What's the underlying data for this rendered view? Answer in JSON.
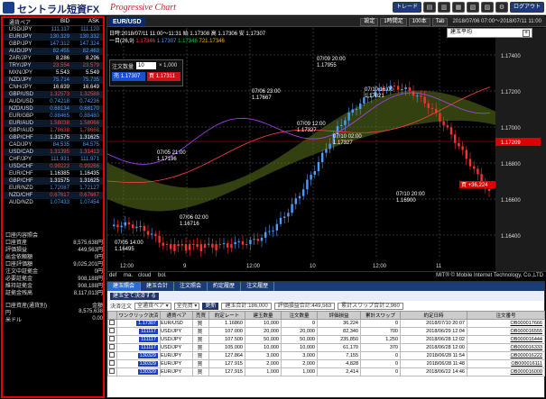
{
  "titlebar": {
    "brand": "セントラル短資FX",
    "brand_sub": "Progressive Chart",
    "trade_btn": "トレード",
    "logout_btn": "ログアウト"
  },
  "rates": {
    "headers": [
      "通貨ペア",
      "BID",
      "ASK"
    ],
    "rows": [
      {
        "pair": "USD/JPY",
        "bid": "111.117",
        "ask": "111.120",
        "dir": "b"
      },
      {
        "pair": "EUR/JPY",
        "bid": "130.329",
        "ask": "130.332",
        "dir": "b"
      },
      {
        "pair": "GBP/JPY",
        "bid": "147.312",
        "ask": "147.324",
        "dir": "b"
      },
      {
        "pair": "AUD/JPY",
        "bid": "82.455",
        "ask": "82.463",
        "dir": "b"
      },
      {
        "pair": "ZAR/JPY",
        "bid": "8.286",
        "ask": "8.296",
        "dir": "w"
      },
      {
        "pair": "TRY/JPY",
        "bid": "23.554",
        "ask": "23.579",
        "dir": "r"
      },
      {
        "pair": "MXN/JPY",
        "bid": "5.543",
        "ask": "5.549",
        "dir": "w"
      },
      {
        "pair": "NZD/JPY",
        "bid": "75.714",
        "ask": "75.735",
        "dir": "b"
      },
      {
        "pair": "CNH/JPY",
        "bid": "16.639",
        "ask": "16.649",
        "dir": "w"
      },
      {
        "pair": "GBP/USD",
        "bid": "1.32573",
        "ask": "1.32588",
        "dir": "r"
      },
      {
        "pair": "AUD/USD",
        "bid": "0.74218",
        "ask": "0.74236",
        "dir": "b"
      },
      {
        "pair": "NZD/USD",
        "bid": "0.68134",
        "ask": "0.68170",
        "dir": "b"
      },
      {
        "pair": "EUR/GBP",
        "bid": "0.88465",
        "ask": "0.88480",
        "dir": "b"
      },
      {
        "pair": "EUR/AUD",
        "bid": "1.58038",
        "ask": "1.58066",
        "dir": "r"
      },
      {
        "pair": "GBP/AUD",
        "bid": "1.78638",
        "ask": "1.78668",
        "dir": "r"
      },
      {
        "pair": "GBP/CHF",
        "bid": "1.31575",
        "ask": "1.31625",
        "dir": "w"
      },
      {
        "pair": "CAD/JPY",
        "bid": "84.535",
        "ask": "84.575",
        "dir": "b"
      },
      {
        "pair": "USD/CAD",
        "bid": "1.31395",
        "ask": "1.31413",
        "dir": "r"
      },
      {
        "pair": "CHF/JPY",
        "bid": "111.931",
        "ask": "111.971",
        "dir": "b"
      },
      {
        "pair": "USD/CHF",
        "bid": "0.99223",
        "ask": "0.99266",
        "dir": "r"
      },
      {
        "pair": "EUR/CHF",
        "bid": "1.16385",
        "ask": "1.16435",
        "dir": "w"
      },
      {
        "pair": "GBP/CHF",
        "bid": "1.31575",
        "ask": "1.31625",
        "dir": "w"
      },
      {
        "pair": "EUR/NZD",
        "bid": "1.72087",
        "ask": "1.72127",
        "dir": "b"
      },
      {
        "pair": "NZD/CHF",
        "bid": "0.67617",
        "ask": "0.67667",
        "dir": "r"
      },
      {
        "pair": "AUD/NZD",
        "bid": "1.07433",
        "ask": "1.07454",
        "dir": "b"
      }
    ]
  },
  "account": {
    "groups": [
      [
        {
          "label": "口座内容照会",
          "value": ""
        },
        {
          "label": "口座資産",
          "value": "8,575,638円"
        },
        {
          "label": "評価損益",
          "value": "449,563円"
        },
        {
          "label": "出金依頼額",
          "value": "0円"
        },
        {
          "label": "口座評価額",
          "value": "9,025,201円"
        },
        {
          "label": "注文中証拠金",
          "value": "0円"
        },
        {
          "label": "必要証拠金",
          "value": "908,188円"
        },
        {
          "label": "維持証拠金",
          "value": "908,188円"
        },
        {
          "label": "証拠金残高",
          "value": "8,117,013円"
        }
      ],
      [
        {
          "label": "口座資産(通貨別)",
          "value": "金額"
        },
        {
          "label": "円",
          "value": "8,575,638"
        },
        {
          "label": "米ドル",
          "value": "0.00"
        }
      ]
    ]
  },
  "chart": {
    "pair_tab": "EUR/USD",
    "tabs": [
      "設定",
      "1時間足",
      "100本",
      "Tab"
    ],
    "date_range": "2018/07/06 07:00〜2018/07/11 11:00",
    "ohlc": "日時:2018/07/11 11:00〜11:31 始 1.17308 高 1.17306 安 1.17307",
    "indicator_prefix": "一目(26,9)",
    "indicator_values": [
      "1.17346",
      "1.17307",
      "1.17346",
      "721.17346"
    ],
    "order_qty_label": "注文数量",
    "order_qty": "10",
    "order_unit": "× 1,000",
    "bid_label": "売",
    "bid": "1.17307",
    "ask_label": "買",
    "ask": "1.17311",
    "side_select": "建玉平均",
    "bottom_tabs": [
      "def",
      "ma.",
      "cloud",
      "bol."
    ],
    "copyright": "MIT® © Mobile Internet Technology, Co.,LTD",
    "y_ticks": [
      "1.17400",
      "1.17200",
      "1.17000",
      "1.16800",
      "1.16600",
      "1.16400"
    ],
    "current_price": "1.17209",
    "position_label": "買 +36,224",
    "x_ticks": [
      "12:00",
      "9",
      "12:00",
      "10",
      "12:00",
      "11"
    ],
    "annotations": [
      {
        "date": "07/06 23:00",
        "price": "1.17667"
      },
      {
        "date": "07/09 12:00",
        "price": "1.17327"
      },
      {
        "date": "07/09 20:00",
        "price": "1.17955"
      },
      {
        "date": "07/10 16:00",
        "price": "1.17821"
      },
      {
        "date": "07/10 02:00",
        "price": "1.17327"
      },
      {
        "date": "07/05 21:00",
        "price": "1.17196"
      },
      {
        "date": "07/06 02:00",
        "price": "1.16716"
      },
      {
        "date": "07/05 14:00",
        "price": "1.16495"
      },
      {
        "date": "07/10 20:00",
        "price": "1.16900"
      }
    ]
  },
  "orders": {
    "tabs": [
      "建玉照会",
      "建玉合計",
      "注文照会",
      "約定履歴",
      "注文履歴"
    ],
    "bulk_btn": "建玉全て決済する",
    "filter_label": "決済注文",
    "filter1": "全通貨ペア ▾",
    "filter2": "全売買 ▾",
    "refresh": "更新",
    "sum1": "建玉合計:186,000",
    "sum2": "評価損益合計:449,563",
    "sum3": "累計スワップ合計:2,960",
    "headers": [
      "",
      "ワンクリック決済",
      "通貨ペア",
      "売買",
      "約定レート",
      "建玉数量",
      "注文数量",
      "評価損益",
      "累計スワップ",
      "約定日時",
      "注文番号"
    ],
    "rows": [
      {
        "oc": "1.17307",
        "pair": "EUR/USD",
        "side": "買",
        "rate": "1.16860",
        "qty": "10,000",
        "oqty": "0",
        "pl": "36,224",
        "swap": "0",
        "date": "2018/07/10 20:07",
        "no": "OB000017666"
      },
      {
        "oc": "111117",
        "pair": "USD/JPY",
        "side": "買",
        "rate": "107.000",
        "qty": "20,000",
        "oqty": "20,000",
        "pl": "82,340",
        "swap": "700",
        "date": "2018/06/29 12:04",
        "no": "OB000016555"
      },
      {
        "oc": "111117",
        "pair": "USD/JPY",
        "side": "買",
        "rate": "107.500",
        "qty": "50,000",
        "oqty": "50,000",
        "pl": "235,850",
        "swap": "1,250",
        "date": "2018/06/28 12:02",
        "no": "OB000016444"
      },
      {
        "oc": "111117",
        "pair": "USD/JPY",
        "side": "買",
        "rate": "105.000",
        "qty": "10,000",
        "oqty": "10,000",
        "pl": "61,170",
        "swap": "370",
        "date": "2018/06/28 12:00",
        "no": "OB000016333"
      },
      {
        "oc": "130329",
        "pair": "EUR/JPY",
        "side": "買",
        "rate": "127.864",
        "qty": "3,000",
        "oqty": "3,000",
        "pl": "7,155",
        "swap": "0",
        "date": "2018/06/28 11:54",
        "no": "OB000016222"
      },
      {
        "oc": "130329",
        "pair": "EUR/JPY",
        "side": "買",
        "rate": "127.915",
        "qty": "2,000",
        "oqty": "2,000",
        "pl": "4,828",
        "swap": "0",
        "date": "2018/06/28 11:48",
        "no": "OB000016111"
      },
      {
        "oc": "130329",
        "pair": "EUR/JPY",
        "side": "買",
        "rate": "127.915",
        "qty": "1,000",
        "oqty": "1,000",
        "pl": "2,414",
        "swap": "0",
        "date": "2018/06/22 14:46",
        "no": "OB000016000"
      }
    ]
  }
}
